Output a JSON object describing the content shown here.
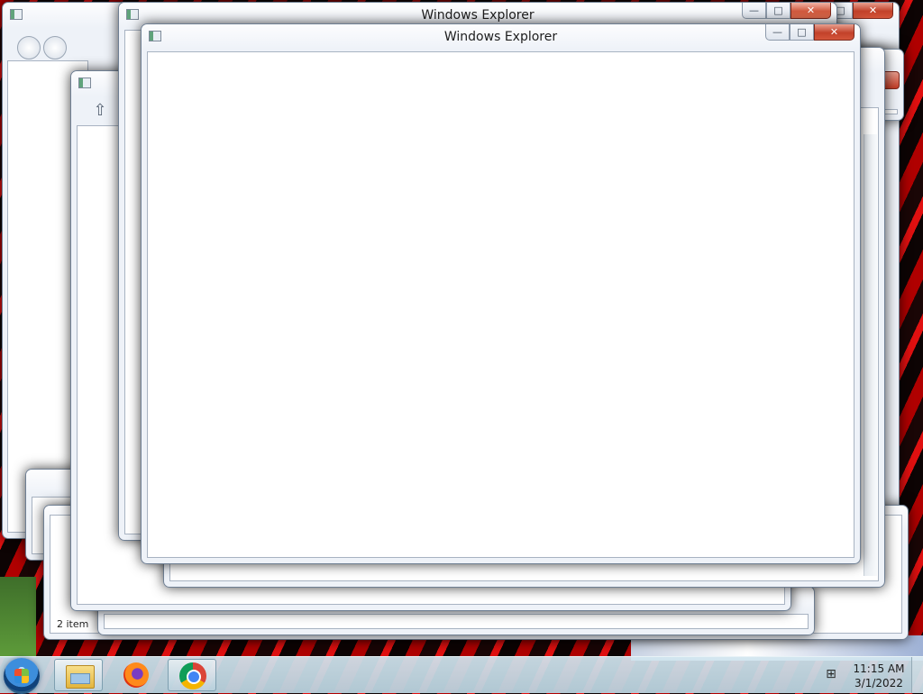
{
  "windows": {
    "main": {
      "title": "Windows Explorer"
    },
    "behind": {
      "title": "Windows Explorer"
    },
    "other_status": {
      "item_count": "2 item"
    }
  },
  "caption_buttons": {
    "minimize": "—",
    "maximize": "□",
    "close": "✕"
  },
  "taskbar": {
    "pinned": [
      "Windows Explorer",
      "Mozilla Firefox",
      "Google Chrome"
    ],
    "clock": {
      "time": "11:15 AM",
      "date": "3/1/2022"
    }
  },
  "icons": {
    "start": "windows-start-orb-icon",
    "explorer": "folder-icon",
    "firefox": "firefox-icon",
    "chrome": "chrome-icon",
    "network": "network-icon",
    "up": "up-arrow-icon"
  },
  "colors": {
    "close_button": "#c2412a",
    "taskbar": "#b9d2de"
  }
}
